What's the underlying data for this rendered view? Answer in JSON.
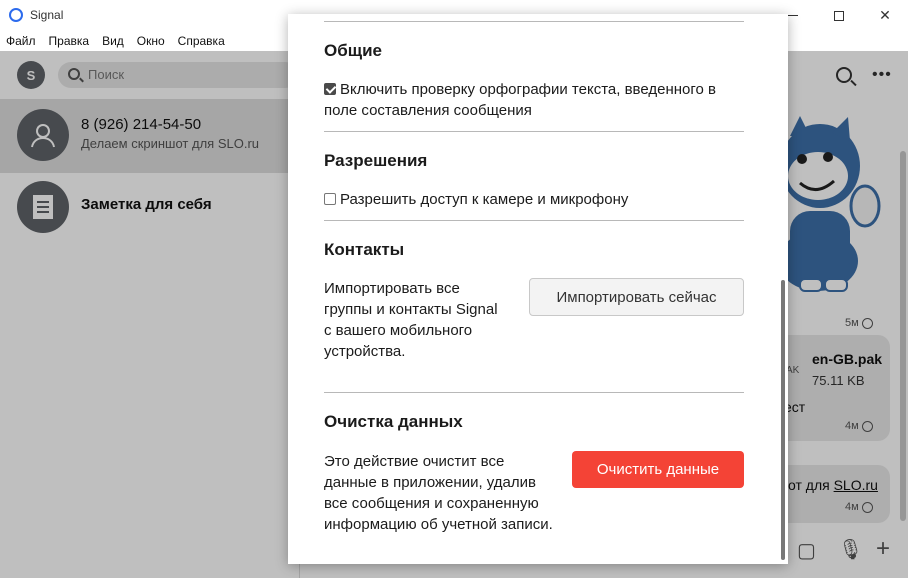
{
  "window": {
    "title": "Signal"
  },
  "menu": [
    "Файл",
    "Правка",
    "Вид",
    "Окно",
    "Справка"
  ],
  "left": {
    "my_avatar_letter": "S",
    "search_placeholder": "Поиск",
    "conversations": [
      {
        "name": "8 (926) 214-54-50",
        "subtitle": "Делаем скриншот для SLO.ru",
        "avatar": "person-icon"
      },
      {
        "name": "Заметка для себя",
        "subtitle": "",
        "avatar": "note-icon"
      }
    ]
  },
  "chat": {
    "times": [
      "5м",
      "4м",
      "4м"
    ],
    "file": {
      "name": "en-GB.pak",
      "size": "75.11 KB",
      "ext": "AK"
    },
    "text_fragment_1": "ест",
    "text_fragment_2": "от для",
    "link_text": "SLO.ru"
  },
  "settings": {
    "general": {
      "title": "Общие",
      "spellcheck_label_line1": "Включить проверку орфографии текста, введенного в",
      "spellcheck_label_line2": "поле составления сообщения",
      "spellcheck_checked": true
    },
    "permissions": {
      "title": "Разрешения",
      "media_label": "Разрешить доступ к камере и микрофону",
      "media_checked": false
    },
    "contacts": {
      "title": "Контакты",
      "desc": [
        "Импортировать все",
        "группы и контакты Signal",
        "с вашего мобильного",
        "устройства."
      ],
      "button": "Импортировать сейчас"
    },
    "clear": {
      "title": "Очистка данных",
      "desc": [
        "Это действие очистит все",
        "данные в приложении, удалив",
        "все сообщения и сохраненную",
        "информацию об учетной записи."
      ],
      "button": "Очистить данные"
    }
  },
  "colors": {
    "accent": "#2c6bed",
    "danger": "#f44336"
  }
}
